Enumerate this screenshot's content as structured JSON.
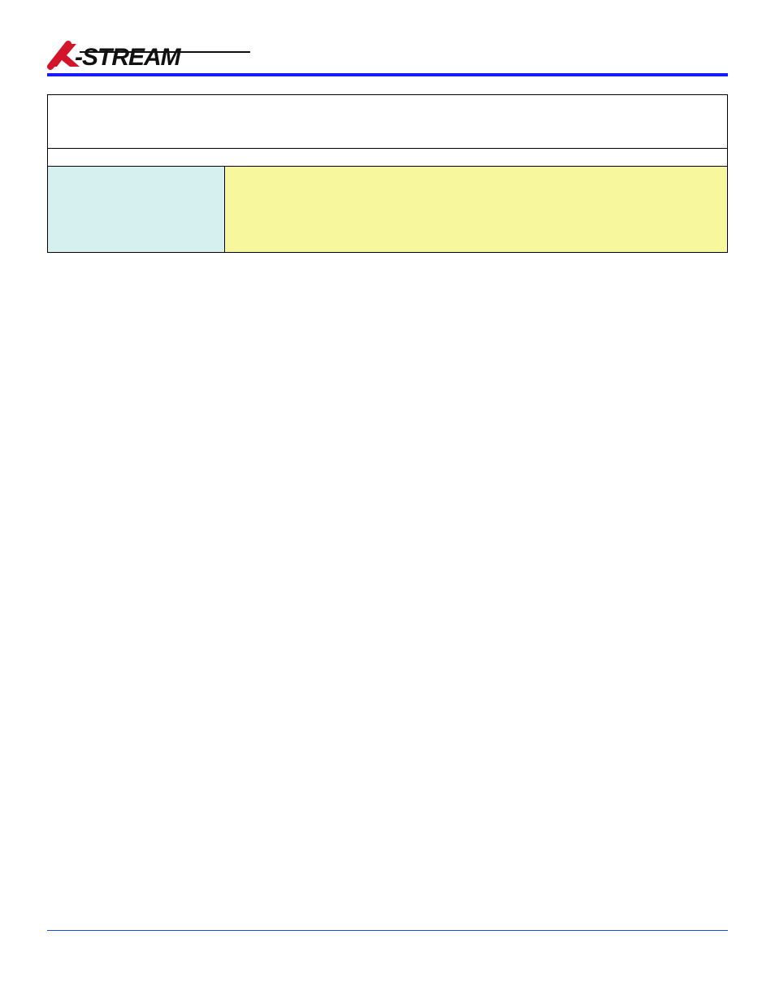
{
  "logo": {
    "alt": "X-STREAM"
  },
  "table": {
    "r1c1": "",
    "r2c1": "",
    "r3c1": "",
    "r3c2": ""
  },
  "footer": {
    "left": "",
    "right": ""
  }
}
